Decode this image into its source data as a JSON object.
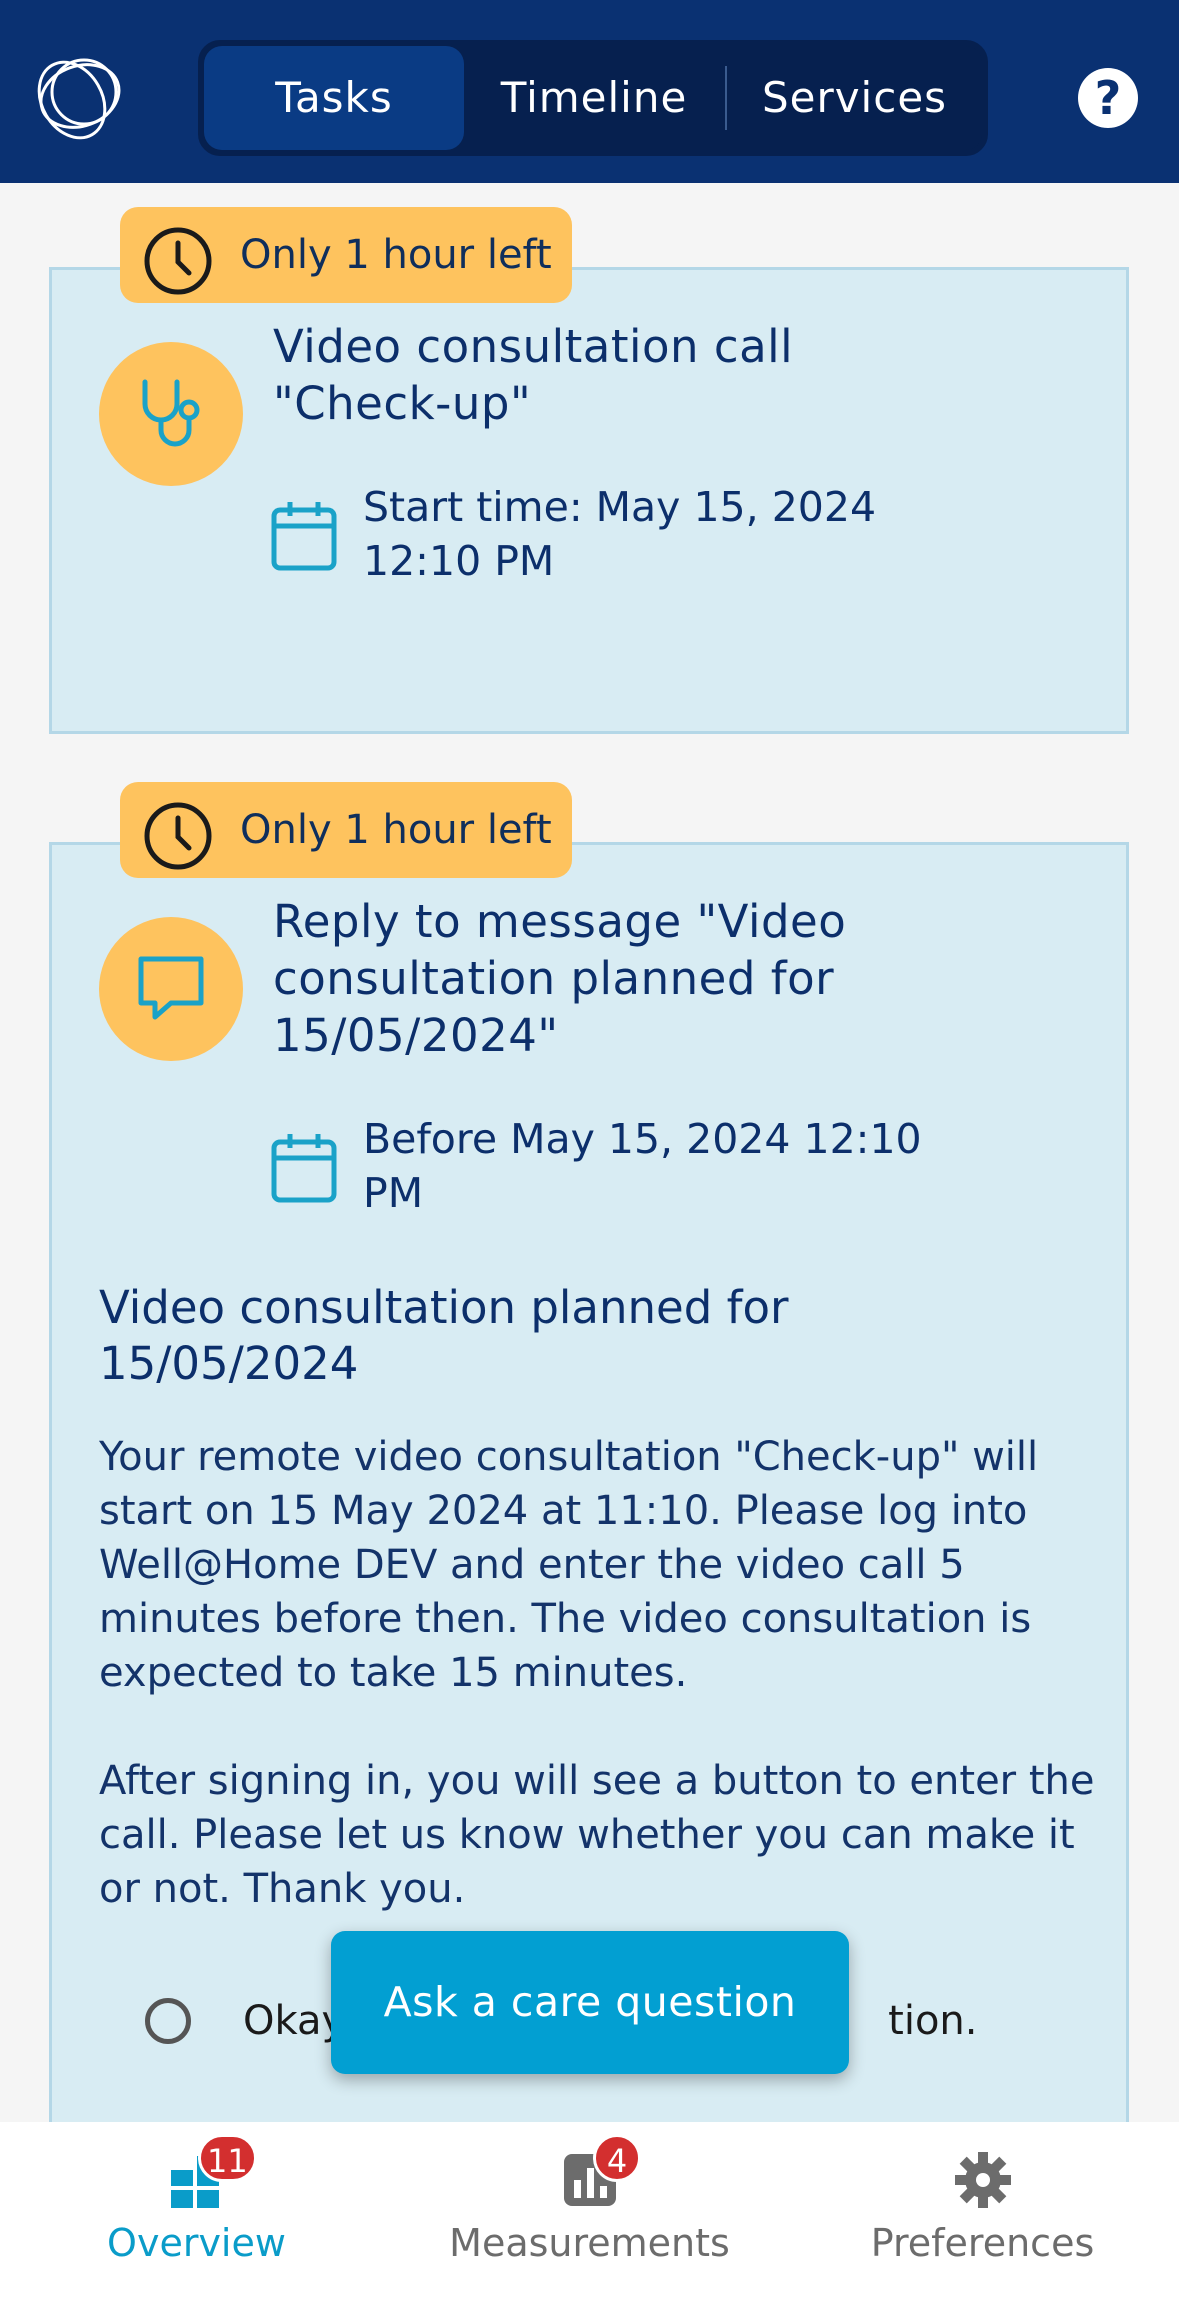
{
  "header": {
    "tabs": [
      {
        "label": "Tasks",
        "active": true
      },
      {
        "label": "Timeline",
        "active": false
      },
      {
        "label": "Services",
        "active": false
      }
    ],
    "help_label": "?"
  },
  "tasks": [
    {
      "badge": "Only 1 hour left",
      "icon": "stethoscope-icon",
      "title_line1": "Video consultation call",
      "title_line2": "\"Check-up\"",
      "date_line1": "Start time: May 15, 2024",
      "date_line2": "12:10 PM"
    },
    {
      "badge": "Only 1 hour left",
      "icon": "message-icon",
      "title_line1": "Reply to message \"Video",
      "title_line2": "consultation planned for",
      "title_line3": "15/05/2024\"",
      "date_line1": "Before May 15, 2024 12:10",
      "date_line2": "PM",
      "message_title_line1": "Video consultation planned for",
      "message_title_line2": "15/05/2024",
      "message_body_1": "Your remote video consultation \"Check-up\" will start on 15 May 2024 at 11:10. Please log into Well@Home DEV and enter the video call 5 minutes before then. The video consultation is expected to take 15 minutes.",
      "message_body_2": "After signing in, you will see a button to enter the call. Please let us know whether you can make it or not. Thank you.",
      "option_visible_start": "Okay",
      "option_visible_end": "tion."
    }
  ],
  "fab_label": "Ask a care question",
  "bottom_nav": [
    {
      "label": "Overview",
      "badge": "11",
      "active": true
    },
    {
      "label": "Measurements",
      "badge": "4",
      "active": false
    },
    {
      "label": "Preferences",
      "badge": "",
      "active": false
    }
  ],
  "colors": {
    "header_bg": "#0a3172",
    "card_bg": "#d8ecf3",
    "badge_bg": "#fec35e",
    "accent": "#029fd2",
    "badge_red": "#d32f2f"
  }
}
